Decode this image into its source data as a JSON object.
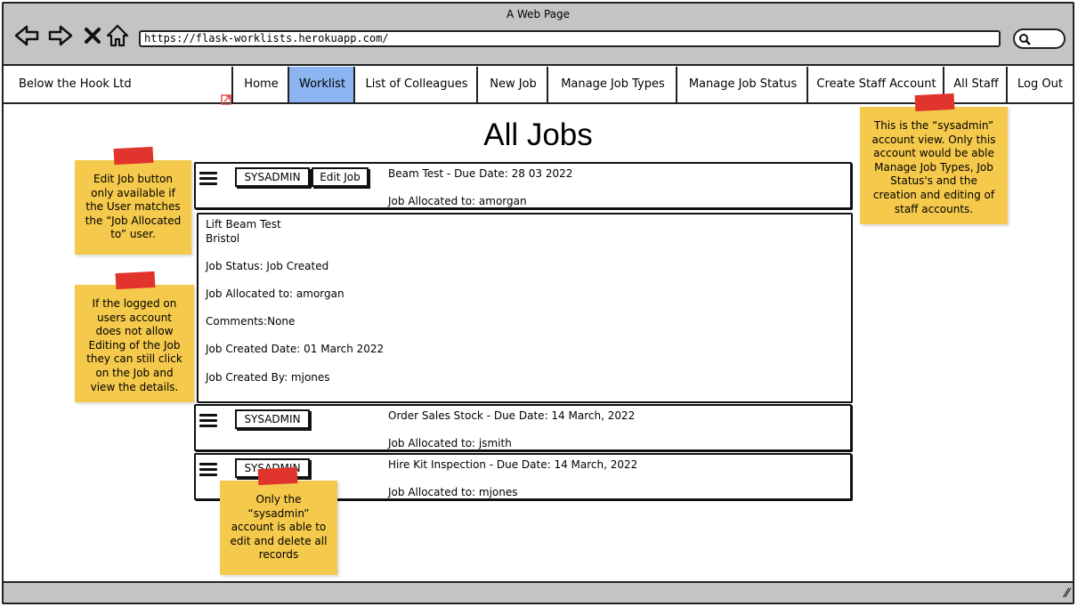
{
  "window": {
    "title": "A Web Page",
    "url": "https://flask-worklists.herokuapp.com/"
  },
  "navbar": {
    "brand": "Below the Hook Ltd",
    "items": [
      "Home",
      "Worklist",
      "List of Colleagues",
      "New Job",
      "Manage Job Types",
      "Manage Job Status",
      "Create Staff Account",
      "All Staff",
      "Log Out"
    ],
    "active_item": "Worklist",
    "active_color": "#8bb4f0"
  },
  "page": {
    "title": "All Jobs"
  },
  "jobs": [
    {
      "badge": "SYSADMIN",
      "edit_label": "Edit Job",
      "title": "Beam Test - Due Date: 28 03 2022",
      "allocated": "Job Allocated to: amorgan",
      "details": {
        "line1": "Lift Beam Test",
        "line2": "Bristol",
        "status": "Job Status: Job Created",
        "allocated": "Job Allocated to: amorgan",
        "comments": "Comments:None",
        "created_date": "Job Created Date: 01 March 2022",
        "created_by": "Job Created By: mjones"
      }
    },
    {
      "badge": "SYSADMIN",
      "title": "Order Sales Stock - Due Date: 14 March, 2022",
      "allocated": "Job Allocated to: jsmith"
    },
    {
      "badge": "SYSADMIN",
      "title": "Hire Kit Inspection - Due Date: 14 March, 2022",
      "allocated": "Job Allocated to: mjones"
    }
  ],
  "notes": {
    "edit_job": "Edit Job button only available if the User matches the “Job Allocated to” user.",
    "view_details": "If the logged on users account does not allow Editing of the Job they can still click on the Job and view the details.",
    "sysadmin_view": "This is the “sysadmin” account view. Only this account would be able Manage Job Types, Job Status's and the creation and editing of staff accounts.",
    "sysadmin_edit": "Only the “sysadmin” account is able to edit and delete all records"
  },
  "colors": {
    "sticky": "#f4c94c",
    "tape": "#e1342c",
    "chrome": "#c4c4c4"
  }
}
